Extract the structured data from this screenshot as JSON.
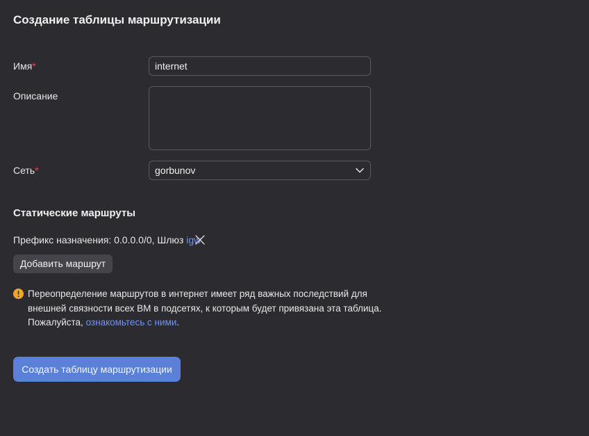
{
  "page": {
    "title": "Создание таблицы маршрутизации"
  },
  "form": {
    "name": {
      "label": "Имя",
      "required_mark": "*",
      "value": "internet"
    },
    "description": {
      "label": "Описание",
      "value": ""
    },
    "network": {
      "label": "Сеть",
      "required_mark": "*",
      "selected": "gorbunov"
    }
  },
  "static_routes": {
    "title": "Статические маршруты",
    "routes": [
      {
        "prefix_text": "Префикс назначения: 0.0.0.0/0, Шлюз ",
        "gateway": "igw"
      }
    ],
    "add_button_label": "Добавить маршрут"
  },
  "warning": {
    "text_before": "Переопределение маршрутов в интернет имеет ряд важных последствий для внешней связности всех ВМ в подсетях, к которым будет привязана эта таблица. Пожалуйста, ",
    "link_text": "ознакомьтесь с ними",
    "text_after": "."
  },
  "submit_button_label": "Создать таблицу маршрутизации",
  "colors": {
    "background": "#2c2b30",
    "accent": "#5a80d8",
    "link": "#6e93ff",
    "required": "#e64b4b",
    "warning": "#f0a62a"
  },
  "icons": {
    "remove_route": "close-icon",
    "select_chevron": "chevron-down-icon",
    "warning": "warning-icon"
  }
}
